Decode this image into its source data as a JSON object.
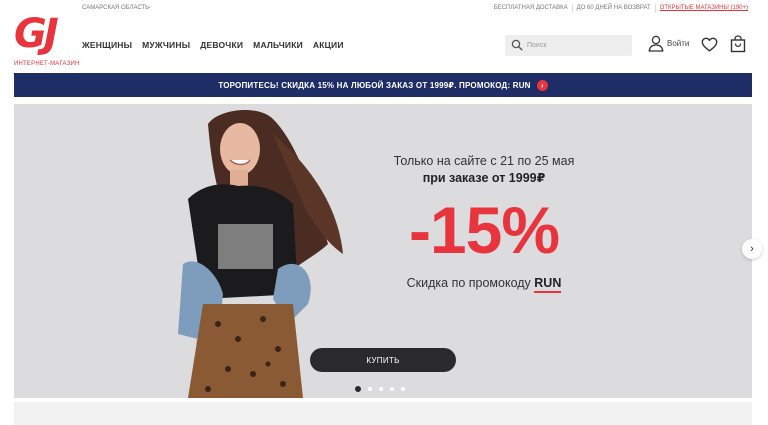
{
  "brand": {
    "logo_text": "GJ",
    "logo_subtitle": "ИНТЕРНЕТ-МАГАЗИН",
    "accent": "#e8343d"
  },
  "header": {
    "region": "САМАРСКАЯ ОБЛАСТЬ",
    "top_links": [
      "БЕСПЛАТНАЯ ДОСТАВКА",
      "ДО 60 ДНЕЙ НА ВОЗВРАТ",
      "ОТКРЫТЫЕ МАГАЗИНЫ (190+)"
    ],
    "nav": [
      "ЖЕНЩИНЫ",
      "МУЖЧИНЫ",
      "ДЕВОЧКИ",
      "МАЛЬЧИКИ",
      "АКЦИИ"
    ],
    "search_placeholder": "Поиск",
    "login_label": "Войти"
  },
  "promo_bar": {
    "text": "ТОРОПИТЕСЬ! СКИДКА 15% НА ЛЮБОЙ ЗАКАЗ ОТ 1999₽. ПРОМОКОД: RUN",
    "bg": "#1f2d66"
  },
  "hero": {
    "line1": "Только на сайте с 21 по 25 мая",
    "line2": "при заказе от 1999₽",
    "discount": "-15%",
    "line3_prefix": "Скидка по промокоду ",
    "promo_code": "RUN",
    "button_label": "КУПИТЬ",
    "slides_total": 5,
    "active_slide": 1
  },
  "icons": [
    "search-icon",
    "user-icon",
    "heart-icon",
    "bag-icon",
    "chevron-right-icon"
  ]
}
